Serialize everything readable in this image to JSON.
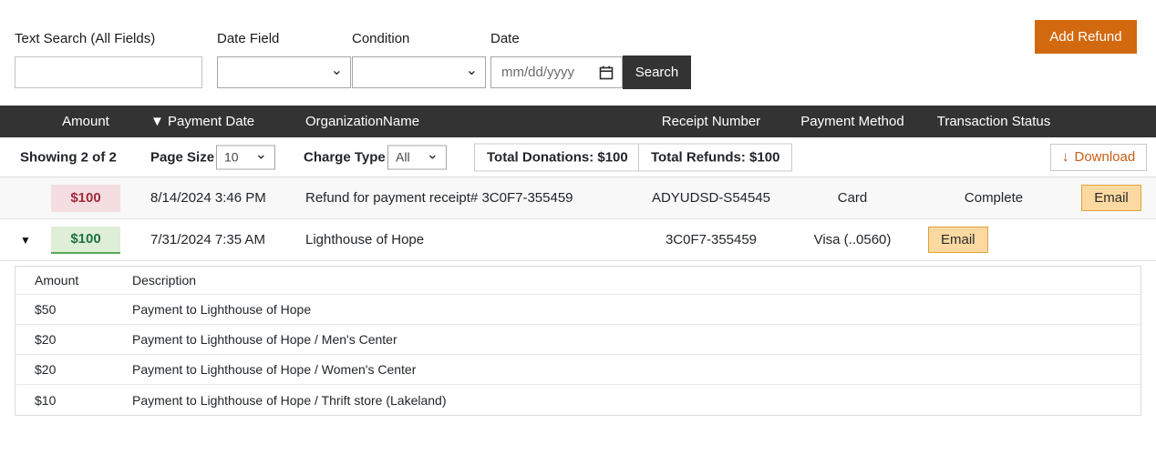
{
  "filters": {
    "text_search_label": "Text Search (All Fields)",
    "date_field_label": "Date Field",
    "condition_label": "Condition",
    "date_label": "Date",
    "date_placeholder": "mm/dd/yyyy",
    "search_button": "Search"
  },
  "add_refund_button": "Add Refund",
  "table": {
    "sort_indicator": "▼",
    "columns": {
      "amount": "Amount",
      "payment_date": "Payment Date",
      "organization": "OrganizationName",
      "receipt": "Receipt Number",
      "method": "Payment Method",
      "status": "Transaction Status"
    }
  },
  "toolbar": {
    "showing": "Showing 2 of 2",
    "page_size_label": "Page Size",
    "page_size_value": "10",
    "charge_type_label": "Charge Type",
    "charge_type_value": "All",
    "total_donations": "Total Donations: $100",
    "total_refunds": "Total Refunds: $100",
    "download_icon": "↓",
    "download_label": "Download"
  },
  "rows": [
    {
      "amount": "$100",
      "payment_date": "8/14/2024 3:46 PM",
      "organization": "Refund for payment receipt# 3C0F7-355459",
      "receipt_number": "ADYUDSD-S54545",
      "payment_method": "Card",
      "transaction_status": "Complete",
      "email_button": "Email"
    },
    {
      "expand_indicator": "▼",
      "amount": "$100",
      "payment_date": "7/31/2024 7:35 AM",
      "organization": "Lighthouse of Hope",
      "receipt_number": "3C0F7-355459",
      "payment_method": "Visa (..0560)",
      "email_button": "Email"
    }
  ],
  "details": {
    "header": {
      "amount": "Amount",
      "description": "Description"
    },
    "rows": [
      {
        "amount": "$50",
        "description": "Payment to Lighthouse of Hope"
      },
      {
        "amount": "$20",
        "description": "Payment to Lighthouse of Hope / Men's Center"
      },
      {
        "amount": "$20",
        "description": "Payment to Lighthouse of Hope / Women's Center"
      },
      {
        "amount": "$10",
        "description": "Payment to Lighthouse of Hope / Thrift store (Lakeland)"
      }
    ]
  },
  "colors": {
    "accent_orange": "#d2690f",
    "dark_header": "#333333",
    "email_button_bg": "#fcd9a1",
    "email_button_border": "#dfa23c",
    "refund_badge_bg": "#f4dee1",
    "refund_badge_text": "#a3293f",
    "donation_badge_bg": "#dfeed6",
    "donation_badge_text": "#1e7145",
    "donation_badge_underline": "#58a758",
    "download_text": "#c95d12"
  }
}
